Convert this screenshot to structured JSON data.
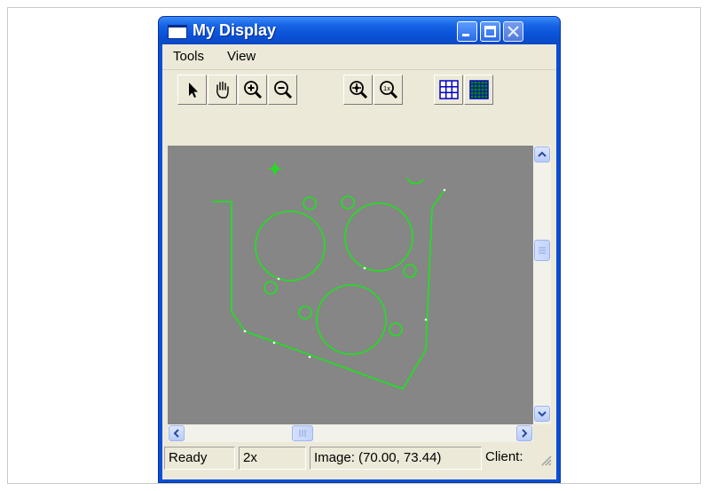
{
  "window": {
    "title": "My Display"
  },
  "menu": {
    "tools": "Tools",
    "view": "View"
  },
  "toolbar": {
    "buttons": [
      {
        "name": "select-arrow",
        "icon": "arrow-pointer-icon"
      },
      {
        "name": "pan-hand",
        "icon": "hand-icon"
      },
      {
        "name": "zoom-in",
        "icon": "zoom-in-icon"
      },
      {
        "name": "zoom-out",
        "icon": "zoom-out-icon"
      },
      {
        "name": "zoom-fit",
        "icon": "zoom-fit-icon"
      },
      {
        "name": "zoom-1x",
        "icon": "zoom-1x-icon",
        "label": "1x"
      },
      {
        "name": "grid-coarse",
        "icon": "grid-icon"
      },
      {
        "name": "grid-fine",
        "icon": "grid-fine-icon"
      }
    ]
  },
  "status": {
    "ready": "Ready",
    "zoom": "2x",
    "image": "Image: (70.00, 73.44)",
    "client": "Client:"
  },
  "colors": {
    "titlebar": "#0a52d8",
    "canvas": "#868686",
    "drawing": "#19e619",
    "chrome": "#ece9d8"
  }
}
